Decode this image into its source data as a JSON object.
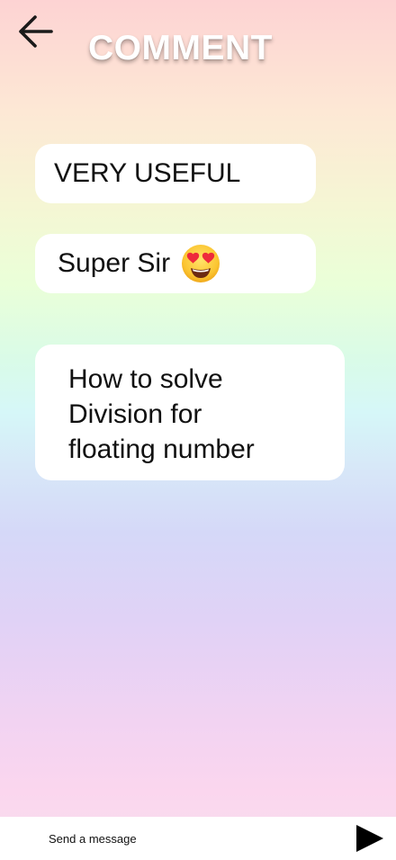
{
  "header": {
    "title": "COMMENT",
    "back_icon": "arrow-left-icon"
  },
  "comments": [
    {
      "text": "VERY USEFUL"
    },
    {
      "text": "Super Sir",
      "emoji": "heart-eyes-emoji-icon"
    },
    {
      "text": "How to solve Division for floating number"
    }
  ],
  "composer": {
    "placeholder": "Send a message",
    "send_icon": "send-play-icon"
  },
  "colors": {
    "bubble_bg": "#ffffff",
    "title_text": "#ffffff",
    "body_text": "#111111",
    "gradient": [
      "#fdd3d3",
      "#fde8d5",
      "#eaffd8",
      "#d6f7f8",
      "#d5d8f8",
      "#e0d2f6",
      "#fbd6ee"
    ]
  }
}
